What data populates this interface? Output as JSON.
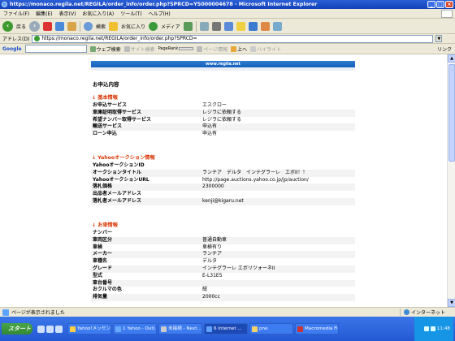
{
  "window": {
    "title": "https://monaco.regila.net/REGILA/order_info/order.php?SPRCD=YS000004678 - Microsoft Internet Explorer"
  },
  "menu": [
    "ファイル(F)",
    "編集(E)",
    "表示(V)",
    "お気に入り(A)",
    "ツール(T)",
    "ヘルプ(H)"
  ],
  "toolbar": {
    "back_label": "戻る",
    "search_label": "検索",
    "favorites_label": "お気に入り",
    "media_label": "メディア"
  },
  "address": {
    "label": "アドレス(D)",
    "url": "https://monaco.regila.net/REGILA/order_info/order.php?SPRCD=",
    "links_label": "リンク"
  },
  "googlebar": {
    "logo": "Google",
    "web_search": "ウェブ検索",
    "site_search": "サイト検索",
    "pagerank": "PageRank",
    "page_info": "ページ情報",
    "up": "上へ",
    "highlight": "ハイライト"
  },
  "page": {
    "banner": "www.regila.net",
    "heading": "お申込内容",
    "sections": [
      {
        "title": "基本情報",
        "rows": [
          {
            "label": "お申込サービス",
            "value": "エスクロー"
          },
          {
            "label": "車庫証明取得サービス",
            "value": "レジラに依頼する"
          },
          {
            "label": "希望ナンバー取得サービス",
            "value": "レジラに依頼する"
          },
          {
            "label": "輸送サービス",
            "value": "申込有"
          },
          {
            "label": "ローン申込",
            "value": "申込有"
          }
        ]
      },
      {
        "title": "Yahooオークション情報",
        "rows": [
          {
            "label": "YahooオークションID",
            "value": ""
          },
          {
            "label": "オークションタイトル",
            "value": "ランチア　デルタ　インテグラーレ　エボII！！"
          },
          {
            "label": "YahooオークションURL",
            "value": "http://page.auctions.yahoo.co.jp/jp/auction/"
          },
          {
            "label": "落札価格",
            "value": "2300000"
          },
          {
            "label": "出品者メールアドレス",
            "value": ""
          },
          {
            "label": "落札者メールアドレス",
            "value": "kenji@kigaru.net"
          }
        ]
      },
      {
        "title": "お車情報",
        "rows": [
          {
            "label": "ナンバー",
            "value": ""
          },
          {
            "label": "車両区分",
            "value": "普通自動車"
          },
          {
            "label": "車検",
            "value": "車検有り"
          },
          {
            "label": "メーカー",
            "value": "ランチア"
          },
          {
            "label": "車種名",
            "value": "デルタ"
          },
          {
            "label": "グレード",
            "value": "インテグラーレ エボリツォーネII"
          },
          {
            "label": "型式",
            "value": "E-L31E5"
          },
          {
            "label": "車台番号",
            "value": ""
          },
          {
            "label": "おクルマの色",
            "value": "紺"
          },
          {
            "label": "排気量",
            "value": "2000cc"
          }
        ]
      }
    ]
  },
  "status": {
    "text": "ページが表示されました",
    "zone": "インターネット"
  },
  "taskbar": {
    "start": "スタート",
    "tasks": [
      "Yahoo!メッセン...",
      "1 Yahoo - Outl...",
      "未接続 - Next...",
      "6 Internet ...",
      "pne",
      "Macromedia Fi..."
    ],
    "active_index": 3,
    "clock": "11:48"
  }
}
